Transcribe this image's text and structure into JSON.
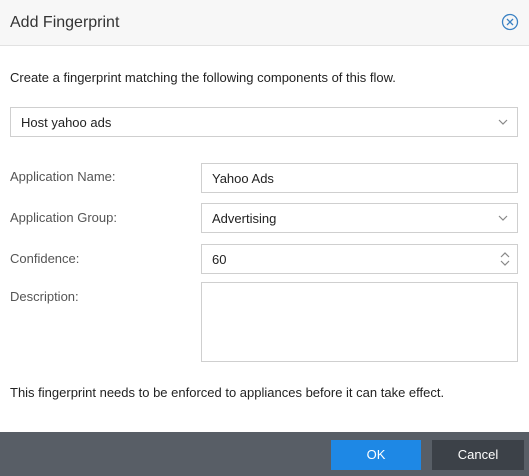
{
  "dialog": {
    "title": "Add Fingerprint",
    "intro": "Create a fingerprint matching the following components of this flow.",
    "component_select": {
      "value": "Host yahoo ads"
    },
    "fields": {
      "application_name": {
        "label": "Application Name:",
        "value": "Yahoo Ads"
      },
      "application_group": {
        "label": "Application Group:",
        "value": "Advertising"
      },
      "confidence": {
        "label": "Confidence:",
        "value": "60"
      },
      "description": {
        "label": "Description:",
        "value": ""
      }
    },
    "note": "This fingerprint needs to be enforced to appliances before it can take effect.",
    "buttons": {
      "ok": "OK",
      "cancel": "Cancel"
    }
  },
  "colors": {
    "accent": "#1e88e5",
    "footer": "#585e66",
    "cancel_button": "#3c4148"
  },
  "icons": {
    "close": "close-circle-icon",
    "dropdown": "chevron-down-icon",
    "spinner": "spinner-up-down-icon"
  }
}
